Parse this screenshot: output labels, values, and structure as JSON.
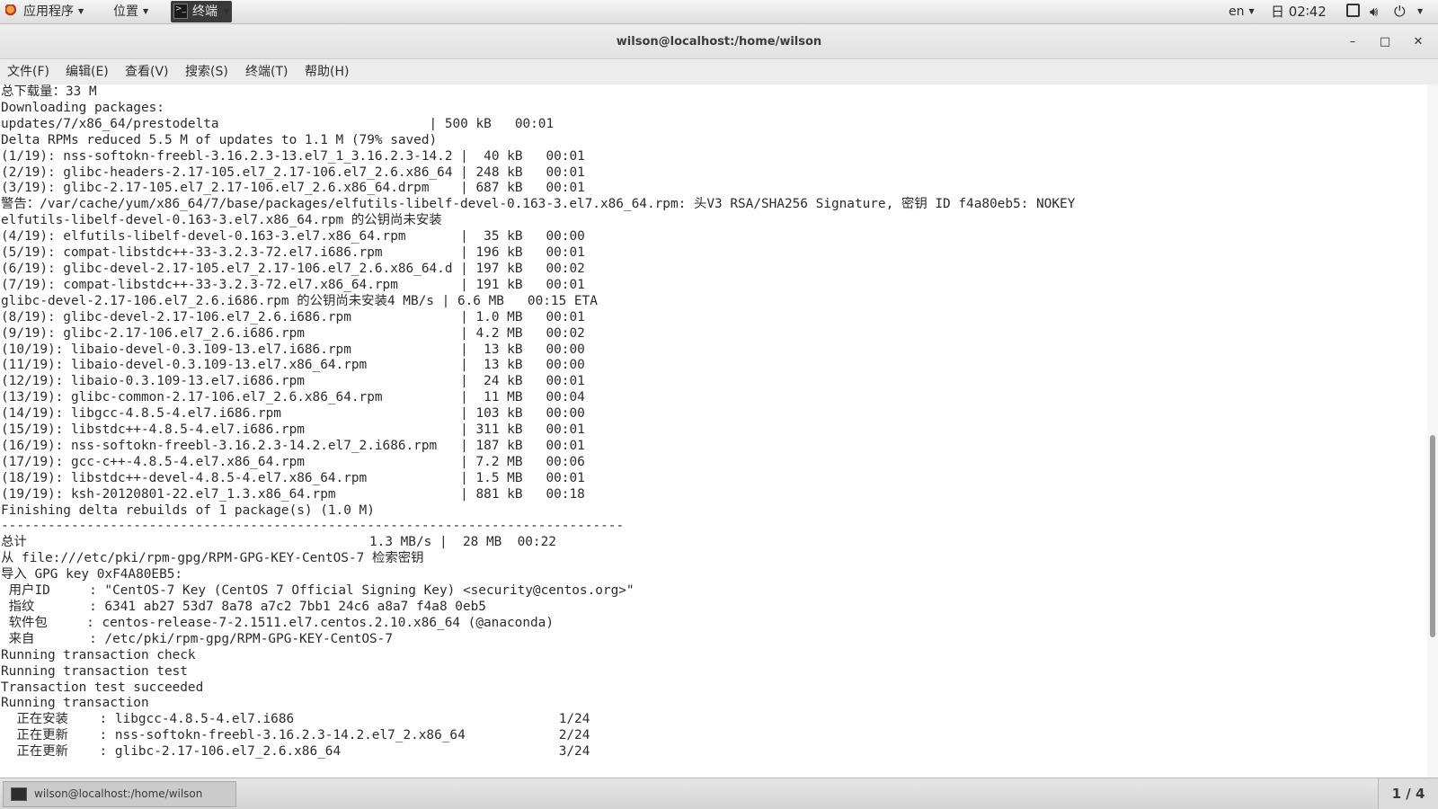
{
  "top_panel": {
    "apps_label": "应用程序",
    "places_label": "位置",
    "terminal_task_label": "终端",
    "input_method": "en",
    "clock": "日 02∶42"
  },
  "window": {
    "title": "wilson@localhost:/home/wilson",
    "minimize": "–",
    "maximize": "□",
    "close": "✕"
  },
  "menu": {
    "file": "文件(F)",
    "edit": "编辑(E)",
    "view": "查看(V)",
    "search": "搜索(S)",
    "terminal": "终端(T)",
    "help": "帮助(H)"
  },
  "terminal": {
    "lines": [
      "总下载量：33 M",
      "Downloading packages:",
      "updates/7/x86_64/prestodelta                           | 500 kB   00:01",
      "Delta RPMs reduced 5.5 M of updates to 1.1 M (79% saved)",
      "(1/19): nss-softokn-freebl-3.16.2.3-13.el7_1_3.16.2.3-14.2 |  40 kB   00:01",
      "(2/19): glibc-headers-2.17-105.el7_2.17-106.el7_2.6.x86_64 | 248 kB   00:01",
      "(3/19): glibc-2.17-105.el7_2.17-106.el7_2.6.x86_64.drpm    | 687 kB   00:01",
      "警告：/var/cache/yum/x86_64/7/base/packages/elfutils-libelf-devel-0.163-3.el7.x86_64.rpm: 头V3 RSA/SHA256 Signature, 密钥 ID f4a80eb5: NOKEY",
      "elfutils-libelf-devel-0.163-3.el7.x86_64.rpm 的公钥尚未安装",
      "(4/19): elfutils-libelf-devel-0.163-3.el7.x86_64.rpm       |  35 kB   00:00",
      "(5/19): compat-libstdc++-33-3.2.3-72.el7.i686.rpm          | 196 kB   00:01",
      "(6/19): glibc-devel-2.17-105.el7_2.17-106.el7_2.6.x86_64.d | 197 kB   00:02",
      "(7/19): compat-libstdc++-33-3.2.3-72.el7.x86_64.rpm        | 191 kB   00:01",
      "glibc-devel-2.17-106.el7_2.6.i686.rpm 的公钥尚未安装4 MB/s | 6.6 MB   00:15 ETA",
      "(8/19): glibc-devel-2.17-106.el7_2.6.i686.rpm              | 1.0 MB   00:01",
      "(9/19): glibc-2.17-106.el7_2.6.i686.rpm                    | 4.2 MB   00:02",
      "(10/19): libaio-devel-0.3.109-13.el7.i686.rpm              |  13 kB   00:00",
      "(11/19): libaio-devel-0.3.109-13.el7.x86_64.rpm            |  13 kB   00:00",
      "(12/19): libaio-0.3.109-13.el7.i686.rpm                    |  24 kB   00:01",
      "(13/19): glibc-common-2.17-106.el7_2.6.x86_64.rpm          |  11 MB   00:04",
      "(14/19): libgcc-4.8.5-4.el7.i686.rpm                       | 103 kB   00:00",
      "(15/19): libstdc++-4.8.5-4.el7.i686.rpm                    | 311 kB   00:01",
      "(16/19): nss-softokn-freebl-3.16.2.3-14.2.el7_2.i686.rpm   | 187 kB   00:01",
      "(17/19): gcc-c++-4.8.5-4.el7.x86_64.rpm                    | 7.2 MB   00:06",
      "(18/19): libstdc++-devel-4.8.5-4.el7.x86_64.rpm            | 1.5 MB   00:01",
      "(19/19): ksh-20120801-22.el7_1.3.x86_64.rpm                | 881 kB   00:18",
      "Finishing delta rebuilds of 1 package(s) (1.0 M)",
      "--------------------------------------------------------------------------------",
      "总计                                            1.3 MB/s |  28 MB  00:22",
      "从 file:///etc/pki/rpm-gpg/RPM-GPG-KEY-CentOS-7 检索密钥",
      "导入 GPG key 0xF4A80EB5:",
      " 用户ID     : \"CentOS-7 Key (CentOS 7 Official Signing Key) <security@centos.org>\"",
      " 指纹       : 6341 ab27 53d7 8a78 a7c2 7bb1 24c6 a8a7 f4a8 0eb5",
      " 软件包     : centos-release-7-2.1511.el7.centos.2.10.x86_64 (@anaconda)",
      " 来自       : /etc/pki/rpm-gpg/RPM-GPG-KEY-CentOS-7",
      "Running transaction check",
      "Running transaction test",
      "Transaction test succeeded",
      "Running transaction",
      "  正在安装    : libgcc-4.8.5-4.el7.i686                                  1/24",
      "  正在更新    : nss-softokn-freebl-3.16.2.3-14.2.el7_2.x86_64            2/24",
      "  正在更新    : glibc-2.17-106.el7_2.6.x86_64                            3/24"
    ]
  },
  "taskbar": {
    "window_label": "wilson@localhost:/home/wilson",
    "workspace": "1 / 4"
  }
}
